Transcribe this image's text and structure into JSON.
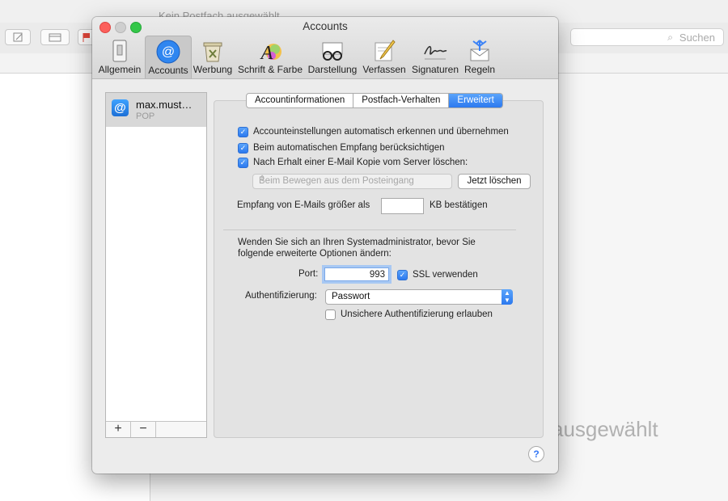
{
  "background_window": {
    "title": "Kein Postfach ausgewählt",
    "search_placeholder": "Suchen",
    "main_text": "ausgewählt"
  },
  "window": {
    "title": "Accounts"
  },
  "toolbar": {
    "items": [
      {
        "label": "Allgemein",
        "icon": "switch-icon"
      },
      {
        "label": "Accounts",
        "icon": "at-icon",
        "selected": true
      },
      {
        "label": "Werbung",
        "icon": "junk-mail-icon"
      },
      {
        "label": "Schrift & Farbe",
        "icon": "font-color-icon"
      },
      {
        "label": "Darstellung",
        "icon": "glasses-icon"
      },
      {
        "label": "Verfassen",
        "icon": "compose-icon"
      },
      {
        "label": "Signaturen",
        "icon": "signature-icon"
      },
      {
        "label": "Regeln",
        "icon": "rules-icon"
      }
    ]
  },
  "accounts": [
    {
      "name": "max.must…",
      "type": "POP"
    }
  ],
  "sidebar_buttons": {
    "add": "+",
    "remove": "−"
  },
  "tabs": [
    "Accountinformationen",
    "Postfach-Verhalten",
    "Erweitert"
  ],
  "active_tab": "Erweitert",
  "advanced": {
    "auto_detect": {
      "label": "Accounteinstellungen automatisch erkennen und übernehmen",
      "checked": true
    },
    "include_auto_fetch": {
      "label": "Beim automatischen Empfang berücksichtigen",
      "checked": true
    },
    "delete_copy": {
      "label": "Nach Erhalt einer E-Mail Kopie vom Server löschen:",
      "checked": true
    },
    "delete_when": "Beim Bewegen aus dem Posteingang",
    "delete_now_button": "Jetzt löschen",
    "confirm_size_prefix": "Empfang von E-Mails größer als",
    "confirm_size_value": "",
    "confirm_size_suffix": "KB bestätigen",
    "admin_note": "Wenden Sie sich an Ihren Systemadministrator, bevor Sie folgende erweiterte Optionen ändern:",
    "port_label": "Port:",
    "port_value": "993",
    "ssl": {
      "label": "SSL verwenden",
      "checked": true
    },
    "auth_label": "Authentifizierung:",
    "auth_value": "Passwort",
    "insecure_auth": {
      "label": "Unsichere Authentifizierung erlauben",
      "checked": false
    }
  },
  "help_label": "?",
  "colors": {
    "accent": "#2c79ef",
    "close": "#fc605c",
    "zoom": "#34c749"
  }
}
